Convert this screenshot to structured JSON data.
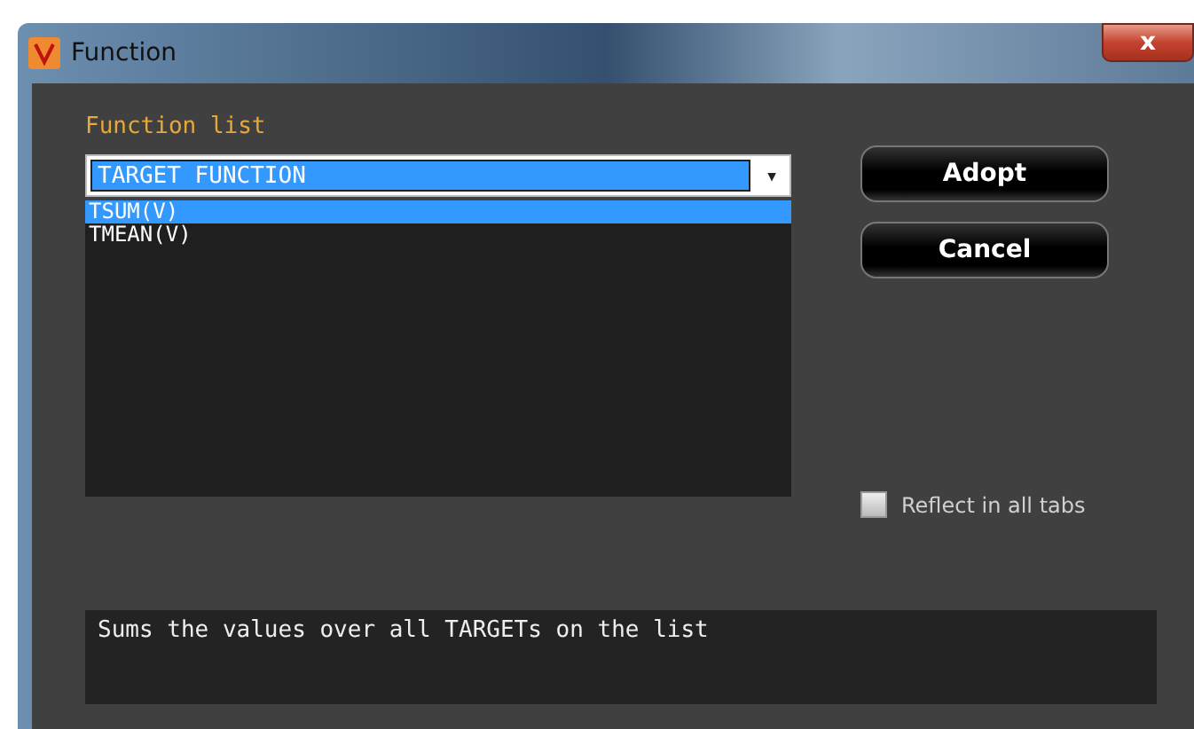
{
  "window": {
    "title": "Function",
    "close": "x"
  },
  "function_list": {
    "label": "Function list",
    "combo_value": "TARGET FUNCTION",
    "combo_arrow": "▼",
    "items": [
      {
        "label": "TSUM(V)",
        "selected": true
      },
      {
        "label": "TMEAN(V)",
        "selected": false
      }
    ]
  },
  "buttons": [
    "Adopt",
    "Cancel"
  ],
  "reflect": {
    "label": "Reflect in all tabs",
    "checked": false
  },
  "description": "Sums the values over all TARGETs on the list"
}
